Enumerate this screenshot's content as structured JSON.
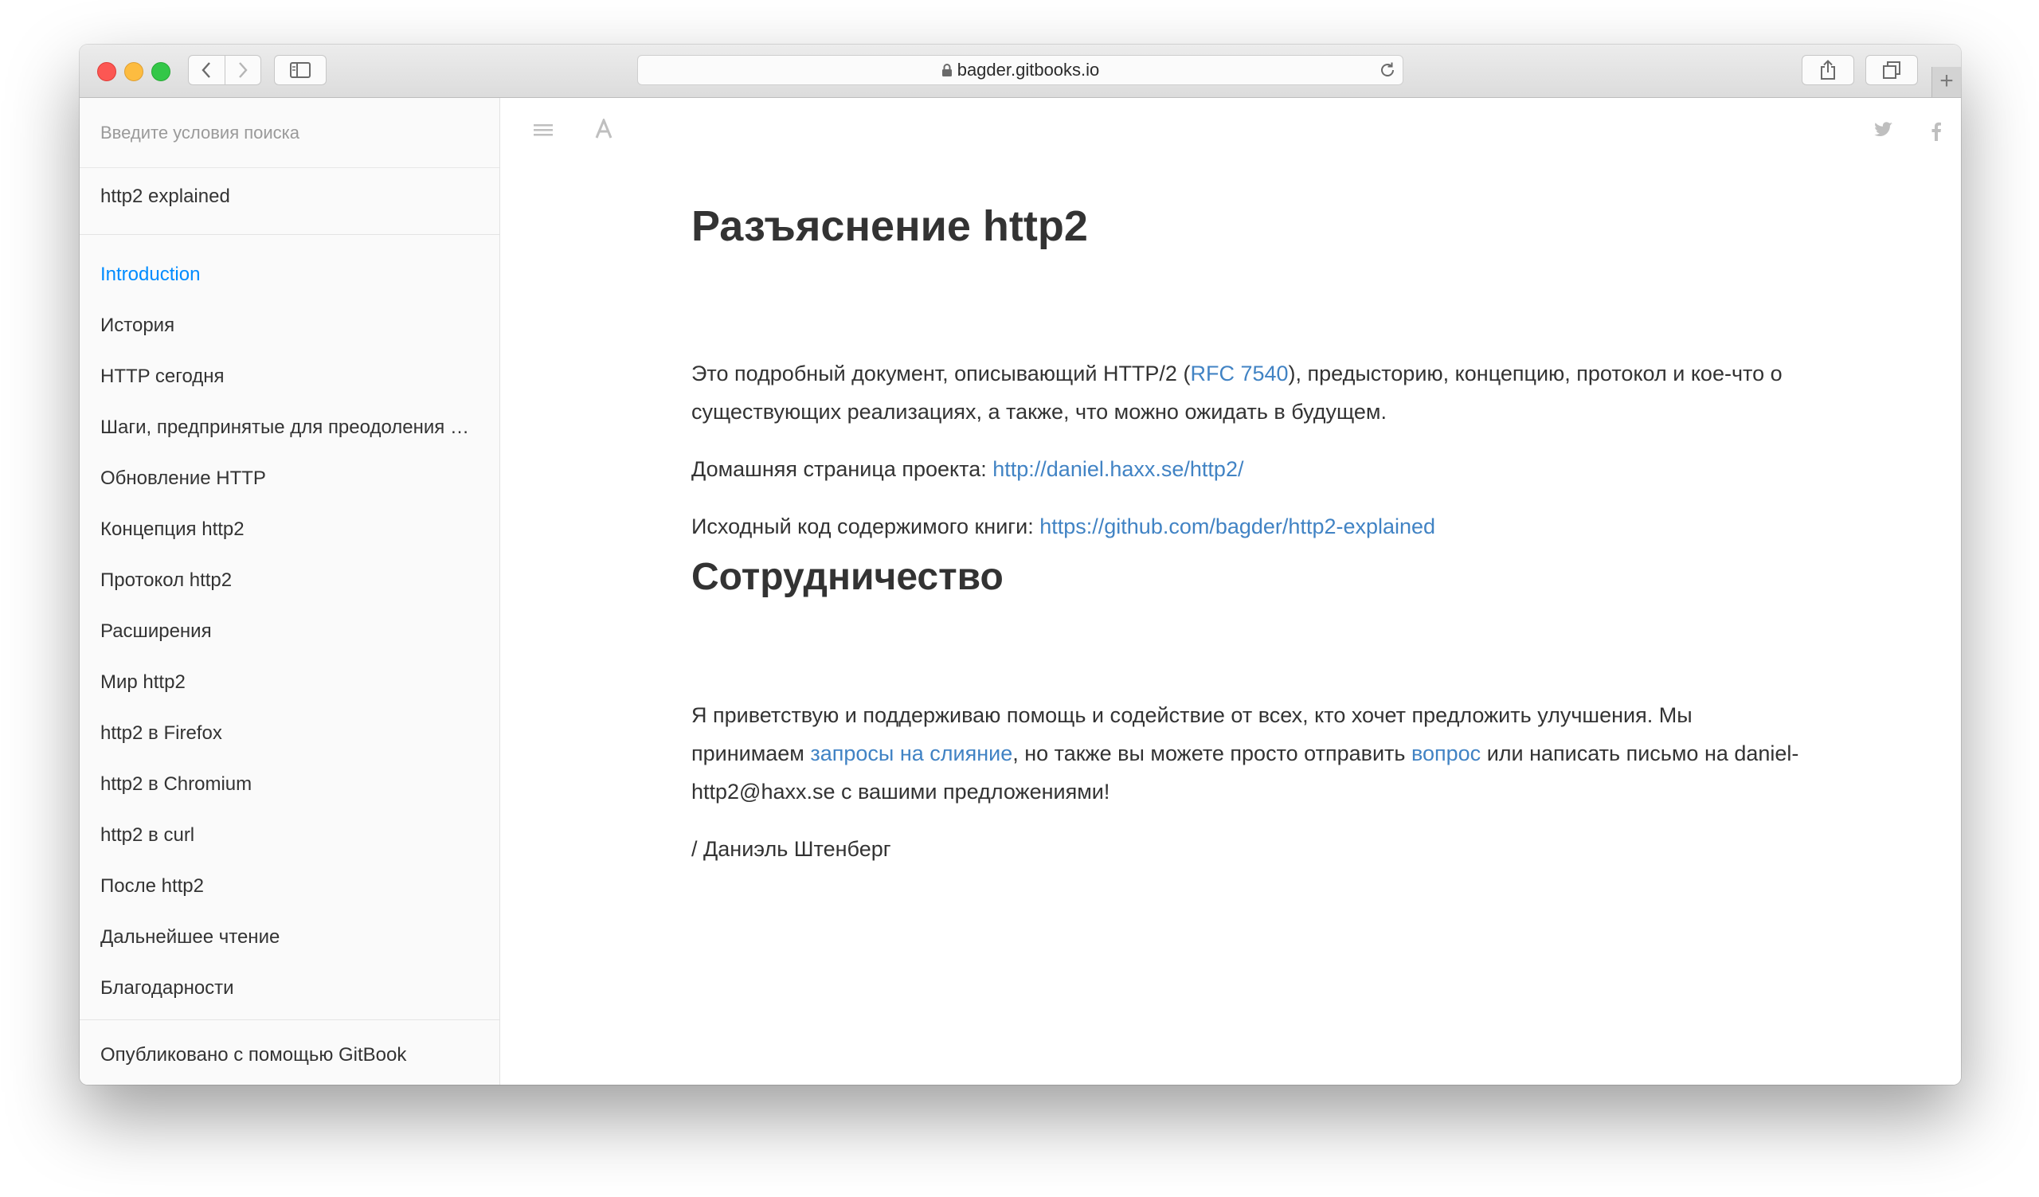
{
  "browser": {
    "url": "bagder.gitbooks.io",
    "new_tab_symbol": "+"
  },
  "sidebar": {
    "search_placeholder": "Введите условия поиска",
    "book_title": "http2 explained",
    "items": [
      {
        "label": "Introduction",
        "active": true
      },
      {
        "label": "История"
      },
      {
        "label": "HTTP сегодня"
      },
      {
        "label": "Шаги, предпринятые для преодоления ограничений"
      },
      {
        "label": "Обновление HTTP"
      },
      {
        "label": "Концепция http2"
      },
      {
        "label": "Протокол http2"
      },
      {
        "label": "Расширения"
      },
      {
        "label": "Мир http2"
      },
      {
        "label": "http2 в Firefox"
      },
      {
        "label": "http2 в Chromium"
      },
      {
        "label": "http2 в curl"
      },
      {
        "label": "После http2"
      },
      {
        "label": "Дальнейшее чтение"
      },
      {
        "label": "Благодарности"
      }
    ],
    "published_with": "Опубликовано с помощью GitBook"
  },
  "page": {
    "title": "Разъяснение http2",
    "p1_before": "Это подробный документ, описывающий HTTP/2 (",
    "p1_link": "RFC 7540",
    "p1_after": "), предысторию, концепцию, протокол и кое-что о существующих реализациях, а также, что можно ожидать в будущем.",
    "homepage_label": "Домашняя страница проекта: ",
    "homepage_link": "http://daniel.haxx.se/http2/",
    "source_label": "Исходный код содержимого книги: ",
    "source_link": "https://github.com/bagder/http2-explained",
    "section_title": "Сотрудничество",
    "p2_before": "Я приветствую и поддерживаю помощь и содействие от всех, кто хочет предложить улучшения. Мы принимаем ",
    "p2_link1": "запросы на слияние",
    "p2_mid": ", но также вы можете просто отправить ",
    "p2_link2": "вопрос",
    "p2_after": " или написать письмо на daniel-http2@haxx.se с вашими предложениями!",
    "signature": "/ Даниэль Штенберг"
  },
  "icons": {
    "toc_toggle": "hamburger-icon",
    "font_settings": "font-a-icon",
    "share_twitter": "twitter-icon",
    "share_facebook": "facebook-icon",
    "share": "share-icon",
    "next_page": "chevron-right-icon"
  },
  "colors": {
    "link": "#4183c4",
    "active_nav": "#008cff",
    "text": "#333333"
  }
}
